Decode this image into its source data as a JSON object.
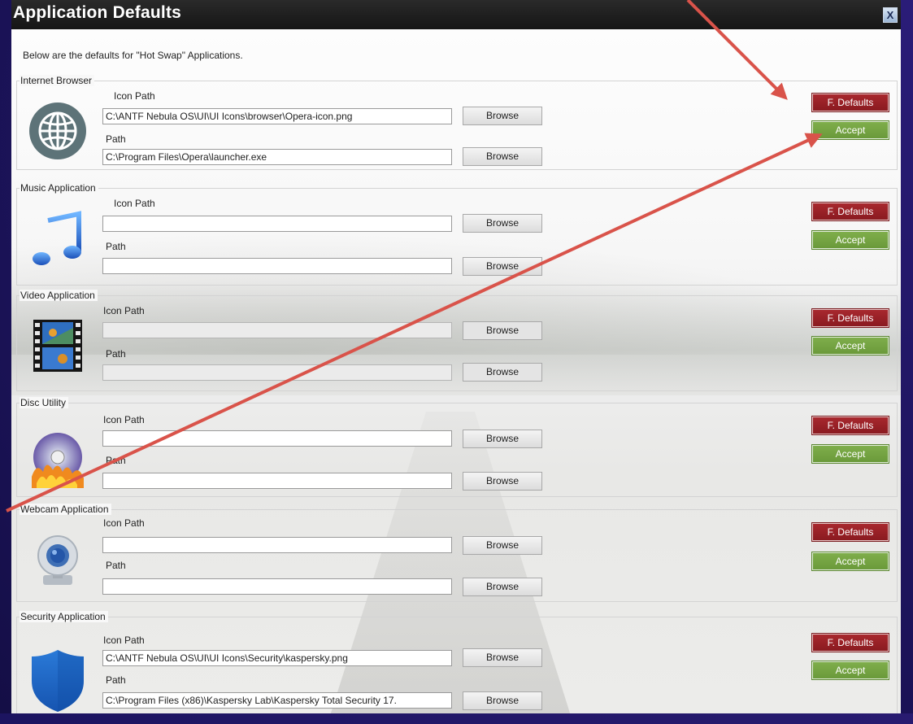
{
  "window": {
    "title": "Application Defaults",
    "close_glyph": "X"
  },
  "intro": "Below are the defaults for \"Hot Swap\" Applications.",
  "labels": {
    "icon_path": "Icon Path",
    "path": "Path",
    "browse": "Browse",
    "f_defaults": "F. Defaults",
    "accept": "Accept"
  },
  "groups": [
    {
      "title": "Internet Browser",
      "icon": "globe-icon",
      "icon_path_value": "C:\\ANTF Nebula OS\\UI\\UI Icons\\browser\\Opera-icon.png",
      "path_value": "C:\\Program Files\\Opera\\launcher.exe",
      "enabled": true
    },
    {
      "title": "Music Application",
      "icon": "music-note-icon",
      "icon_path_value": "",
      "path_value": "",
      "enabled": true
    },
    {
      "title": "Video Application",
      "icon": "film-strip-icon",
      "icon_path_value": "",
      "path_value": "",
      "enabled": false
    },
    {
      "title": "Disc Utility",
      "icon": "burning-disc-icon",
      "icon_path_value": "",
      "path_value": "",
      "enabled": true
    },
    {
      "title": "Webcam Application",
      "icon": "webcam-icon",
      "icon_path_value": "",
      "path_value": "",
      "enabled": true
    },
    {
      "title": "Security Application",
      "icon": "shield-icon",
      "icon_path_value": "C:\\ANTF Nebula OS\\UI\\UI Icons\\Security\\kaspersky.png",
      "path_value": "C:\\Program Files (x86)\\Kaspersky Lab\\Kaspersky Total Security 17.",
      "enabled": true
    }
  ],
  "colors": {
    "titlebar": "#1e1e1e",
    "f_defaults": "#9a2228",
    "accept": "#76a544",
    "annotation_arrow": "#d9534a",
    "background": "#1e1560"
  }
}
